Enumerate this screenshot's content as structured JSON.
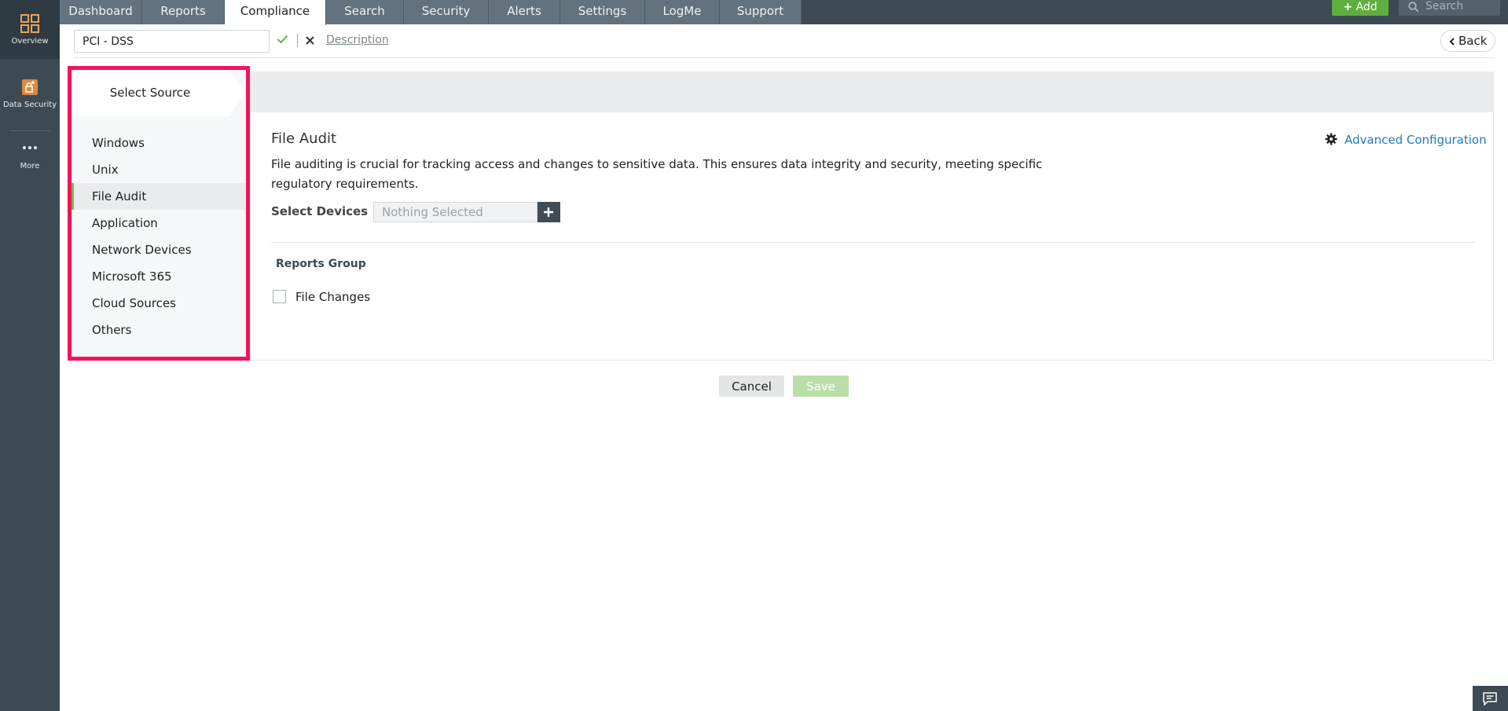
{
  "rail": {
    "items": [
      {
        "label": "Overview",
        "icon": "grid-icon"
      },
      {
        "label": "Data Security",
        "icon": "data-security-icon"
      },
      {
        "label": "More",
        "icon": "more-dots-icon"
      }
    ]
  },
  "topnav": {
    "tabs": [
      "Dashboard",
      "Reports",
      "Compliance",
      "Search",
      "Security",
      "Alerts",
      "Settings",
      "LogMe",
      "Support"
    ],
    "active_tab": "Compliance",
    "add_label": "Add",
    "search_placeholder": "Search"
  },
  "titlebar": {
    "name_value": "PCI - DSS",
    "description_link": "Description",
    "back_label": "Back"
  },
  "source_panel": {
    "heading": "Select Source",
    "items": [
      "Windows",
      "Unix",
      "File Audit",
      "Application",
      "Network Devices",
      "Microsoft 365",
      "Cloud Sources",
      "Others"
    ],
    "selected": "File Audit"
  },
  "main": {
    "section_title": "File Audit",
    "description": "File auditing is crucial for tracking access and changes to sensitive data. This ensures data integrity and security, meeting specific regulatory requirements.",
    "advanced_config": "Advanced Configuration",
    "select_devices_label": "Select Devices",
    "devices_placeholder": "Nothing Selected",
    "reports_group_title": "Reports Group",
    "report_checkbox_label": "File Changes"
  },
  "actions": {
    "cancel": "Cancel",
    "save": "Save"
  },
  "colors": {
    "accent_green": "#6cbb4a",
    "highlight_border": "#f4135a",
    "link_blue": "#1f7bc1",
    "nav_dark": "#3d4a53"
  }
}
